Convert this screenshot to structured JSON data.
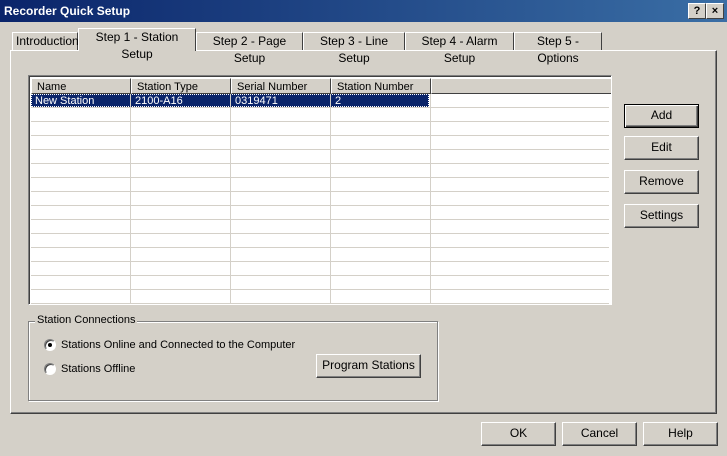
{
  "window": {
    "title": "Recorder Quick Setup",
    "help_button": "?",
    "close_button": "×"
  },
  "tabs": [
    {
      "label": "Introduction"
    },
    {
      "label": "Step 1 - Station Setup",
      "active": true
    },
    {
      "label": "Step 2 - Page Setup"
    },
    {
      "label": "Step 3 - Line Setup"
    },
    {
      "label": "Step 4 - Alarm Setup"
    },
    {
      "label": "Step 5 - Options"
    }
  ],
  "stations": {
    "columns": [
      "Name",
      "Station Type",
      "Serial Number",
      "Station Number"
    ],
    "rows": [
      {
        "name": "New Station",
        "type": "2100-A16",
        "serial": "0319471",
        "number": "2",
        "selected": true
      }
    ]
  },
  "side_buttons": {
    "add": "Add",
    "edit": "Edit",
    "remove": "Remove",
    "settings": "Settings"
  },
  "connections": {
    "label": "Station Connections",
    "online_label": "Stations Online and Connected to the Computer",
    "offline_label": "Stations Offline",
    "selected": "online",
    "program_button": "Program Stations"
  },
  "footer": {
    "ok": "OK",
    "cancel": "Cancel",
    "help": "Help"
  }
}
